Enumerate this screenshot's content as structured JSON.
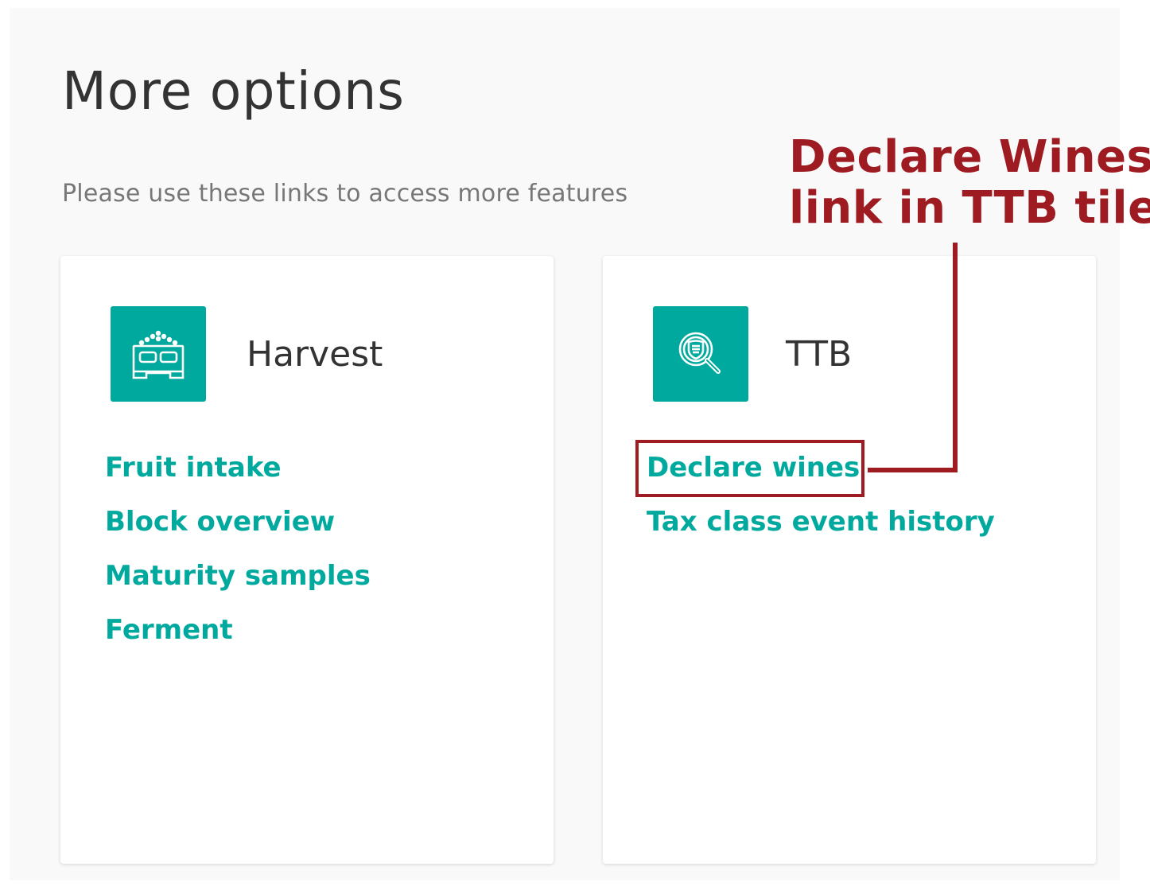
{
  "header": {
    "title": "More options",
    "subtitle": "Please use these links to access more features"
  },
  "tiles": [
    {
      "title": "Harvest",
      "icon": "harvest-bin-icon",
      "links": [
        "Fruit intake",
        "Block overview",
        "Maturity samples",
        "Ferment"
      ]
    },
    {
      "title": "TTB",
      "icon": "badge-search-icon",
      "links": [
        "Declare wines",
        "Tax class event history"
      ]
    }
  ],
  "annotation": {
    "line1": "Declare Wines",
    "line2": "link in TTB tile"
  },
  "colors": {
    "accent": "#00a99d",
    "annotation": "#9e1b22",
    "background": "#f9f9f9"
  }
}
